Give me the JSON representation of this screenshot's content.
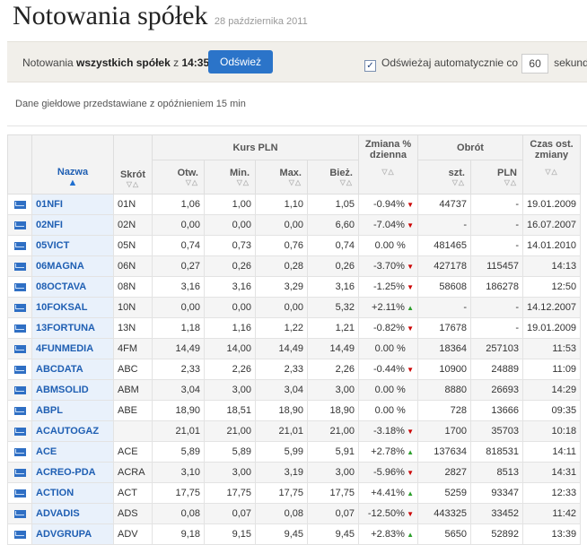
{
  "header": {
    "title": "Notowania spółek",
    "date": "28 października 2011"
  },
  "toolbar": {
    "text_prefix": "Notowania ",
    "text_bold": "wszystkich spółek",
    "text_mid": " z ",
    "time": "14:35",
    "refresh_label": "Odśwież",
    "auto_label": "Odświeżaj automatycznie co",
    "auto_checked": true,
    "seconds_value": "60",
    "seconds_label": "sekund"
  },
  "notice": "Dane giełdowe przedstawiane z opóźnieniem 15 min",
  "table": {
    "headers": {
      "name": "Nazwa",
      "ticker": "Skrót",
      "price_group": "Kurs PLN",
      "open": "Otw.",
      "min": "Min.",
      "max": "Max.",
      "current": "Bież.",
      "change": "Zmiana % dzienna",
      "volume_group": "Obrót",
      "qty": "szt.",
      "pln": "PLN",
      "time": "Czas ost. zmiany"
    },
    "rows": [
      [
        "01NFI",
        "01N",
        "1,06",
        "1,00",
        "1,10",
        "1,05",
        "-0.94%",
        "down",
        "44737",
        "-",
        "19.01.2009"
      ],
      [
        "02NFI",
        "02N",
        "0,00",
        "0,00",
        "0,00",
        "6,60",
        "-7.04%",
        "down",
        "-",
        "-",
        "16.07.2007"
      ],
      [
        "05VICT",
        "05N",
        "0,74",
        "0,73",
        "0,76",
        "0,74",
        "0.00 %",
        "",
        "481465",
        "-",
        "14.01.2010"
      ],
      [
        "06MAGNA",
        "06N",
        "0,27",
        "0,26",
        "0,28",
        "0,26",
        "-3.70%",
        "down",
        "427178",
        "115457",
        "14:13"
      ],
      [
        "08OCTAVA",
        "08N",
        "3,16",
        "3,16",
        "3,29",
        "3,16",
        "-1.25%",
        "down",
        "58608",
        "186278",
        "12:50"
      ],
      [
        "10FOKSAL",
        "10N",
        "0,00",
        "0,00",
        "0,00",
        "5,32",
        "+2.11%",
        "up",
        "-",
        "-",
        "14.12.2007"
      ],
      [
        "13FORTUNA",
        "13N",
        "1,18",
        "1,16",
        "1,22",
        "1,21",
        "-0.82%",
        "down",
        "17678",
        "-",
        "19.01.2009"
      ],
      [
        "4FUNMEDIA",
        "4FM",
        "14,49",
        "14,00",
        "14,49",
        "14,49",
        "0.00 %",
        "",
        "18364",
        "257103",
        "11:53"
      ],
      [
        "ABCDATA",
        "ABC",
        "2,33",
        "2,26",
        "2,33",
        "2,26",
        "-0.44%",
        "down",
        "10900",
        "24889",
        "11:09"
      ],
      [
        "ABMSOLID",
        "ABM",
        "3,04",
        "3,00",
        "3,04",
        "3,00",
        "0.00 %",
        "",
        "8880",
        "26693",
        "14:29"
      ],
      [
        "ABPL",
        "ABE",
        "18,90",
        "18,51",
        "18,90",
        "18,90",
        "0.00 %",
        "",
        "728",
        "13666",
        "09:35"
      ],
      [
        "ACAUTOGAZ",
        "",
        "21,01",
        "21,00",
        "21,01",
        "21,00",
        "-3.18%",
        "down",
        "1700",
        "35703",
        "10:18"
      ],
      [
        "ACE",
        "ACE",
        "5,89",
        "5,89",
        "5,99",
        "5,91",
        "+2.78%",
        "up",
        "137634",
        "818531",
        "14:11"
      ],
      [
        "ACREO-PDA",
        "ACRA",
        "3,10",
        "3,00",
        "3,19",
        "3,00",
        "-5.96%",
        "down",
        "2827",
        "8513",
        "14:31"
      ],
      [
        "ACTION",
        "ACT",
        "17,75",
        "17,75",
        "17,75",
        "17,75",
        "+4.41%",
        "up",
        "5259",
        "93347",
        "12:33"
      ],
      [
        "ADVADIS",
        "ADS",
        "0,08",
        "0,07",
        "0,08",
        "0,07",
        "-12.50%",
        "down",
        "443325",
        "33452",
        "11:42"
      ],
      [
        "ADVGRUPA",
        "ADV",
        "9,18",
        "9,15",
        "9,45",
        "9,45",
        "+2.83%",
        "up",
        "5650",
        "52892",
        "13:39"
      ]
    ]
  }
}
